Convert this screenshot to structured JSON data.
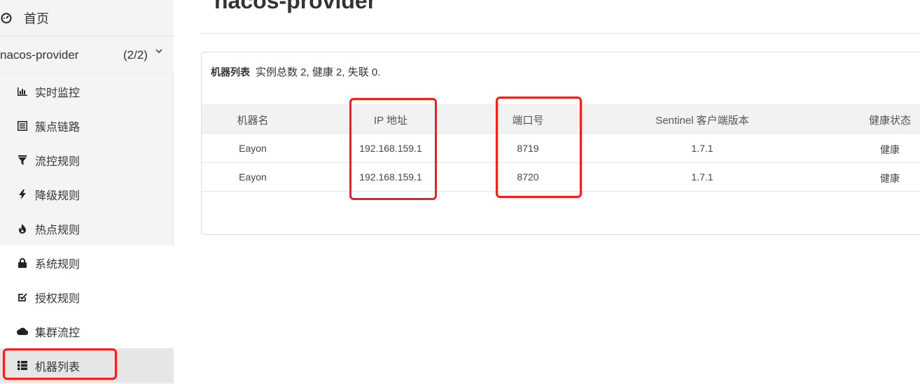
{
  "sidebar": {
    "home_label": "首页",
    "app": {
      "name": "nacos-provider",
      "count": "(2/2)"
    },
    "items": [
      {
        "label": "实时监控",
        "icon": "bar-chart-icon"
      },
      {
        "label": "簇点链路",
        "icon": "list-alt-icon"
      },
      {
        "label": "流控规则",
        "icon": "filter-icon"
      },
      {
        "label": "降级规则",
        "icon": "flash-icon"
      },
      {
        "label": "热点规则",
        "icon": "fire-icon"
      },
      {
        "label": "系统规则",
        "icon": "lock-icon"
      },
      {
        "label": "授权规则",
        "icon": "check-square-icon"
      },
      {
        "label": "集群流控",
        "icon": "cloud-icon"
      },
      {
        "label": "机器列表",
        "icon": "th-list-icon"
      }
    ]
  },
  "main": {
    "title": "nacos-provider",
    "panel": {
      "heading": "机器列表",
      "summary": "实例总数 2, 健康 2, 失联 0.",
      "columns": [
        "机器名",
        "IP 地址",
        "端口号",
        "Sentinel 客户端版本",
        "健康状态"
      ],
      "rows": [
        [
          "Eayon",
          "192.168.159.1",
          "8719",
          "1.7.1",
          "健康"
        ],
        [
          "Eayon",
          "192.168.159.1",
          "8720",
          "1.7.1",
          "健康"
        ]
      ]
    }
  },
  "colors": {
    "highlight": "#ff1a1a",
    "sidebar_bg": "#f4f4f4",
    "active_bg": "#e6e6e6"
  }
}
